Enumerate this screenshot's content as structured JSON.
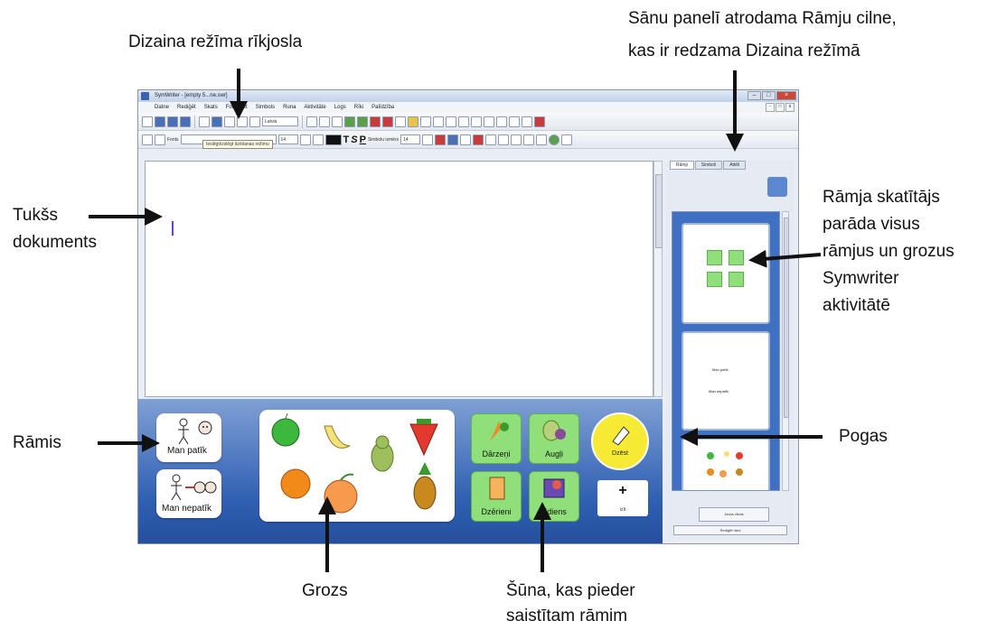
{
  "annotations": {
    "toolbar_label": "Dizaina režīma rīkjosla",
    "tab_label_line1": "Sānu panelī atrodama Rāmju cilne,",
    "tab_label_line2": "kas ir redzama Dizaina režīmā",
    "empty_doc_line1": "Tukšs",
    "empty_doc_line2": "dokuments",
    "viewer_line1": "Rāmja skatītājs",
    "viewer_line2": "parāda visus",
    "viewer_line3": "rāmjus un grozus",
    "viewer_line4": "Symwriter",
    "viewer_line5": "aktivitātē",
    "frame_label": "Rāmis",
    "buttons_label": "Pogas",
    "grid_label": "Grozs",
    "cell_line1": "Šūna, kas pieder",
    "cell_line2": "saistītam rāmim"
  },
  "window": {
    "title": "SymWriter - [empty 5...ne.swr]",
    "menu": [
      "Datne",
      "Rediģēt",
      "Skats",
      "Formatēt",
      "Simbols",
      "Runa",
      "Aktivitāte",
      "Logs",
      "Rīki",
      "Palīdzība"
    ],
    "tooltip": "Ieslēgt/izslēgt dzēšanas režīmu",
    "font_label": "Fonts",
    "font_size": "14",
    "style_combo": "Latvia",
    "symbol_size_label": "Simbolu izmērs",
    "symbol_size": "14"
  },
  "frame": {
    "phrase1": "Man  patīk",
    "phrase2": "Man  nepatīk"
  },
  "buttons": {
    "b1": "Dārzeņi",
    "b2": "Augļi",
    "b3": "Dzērieni",
    "b4": "Ēdiens",
    "round": "Dzēst",
    "add": "Izīt"
  },
  "sidebar": {
    "tabs": [
      "Rāmji",
      "Simboli",
      "Attēli"
    ],
    "mini_phrase1": "Man  patīk",
    "mini_phrase2": "Man  nepatīk",
    "btn_main": "Jauns rāmis",
    "btn_edit": "Rediģēt rāmi"
  },
  "colors": {
    "accent_blue": "#3f70c2",
    "button_green": "#8fe07a",
    "round_yellow": "#f7ea35"
  }
}
